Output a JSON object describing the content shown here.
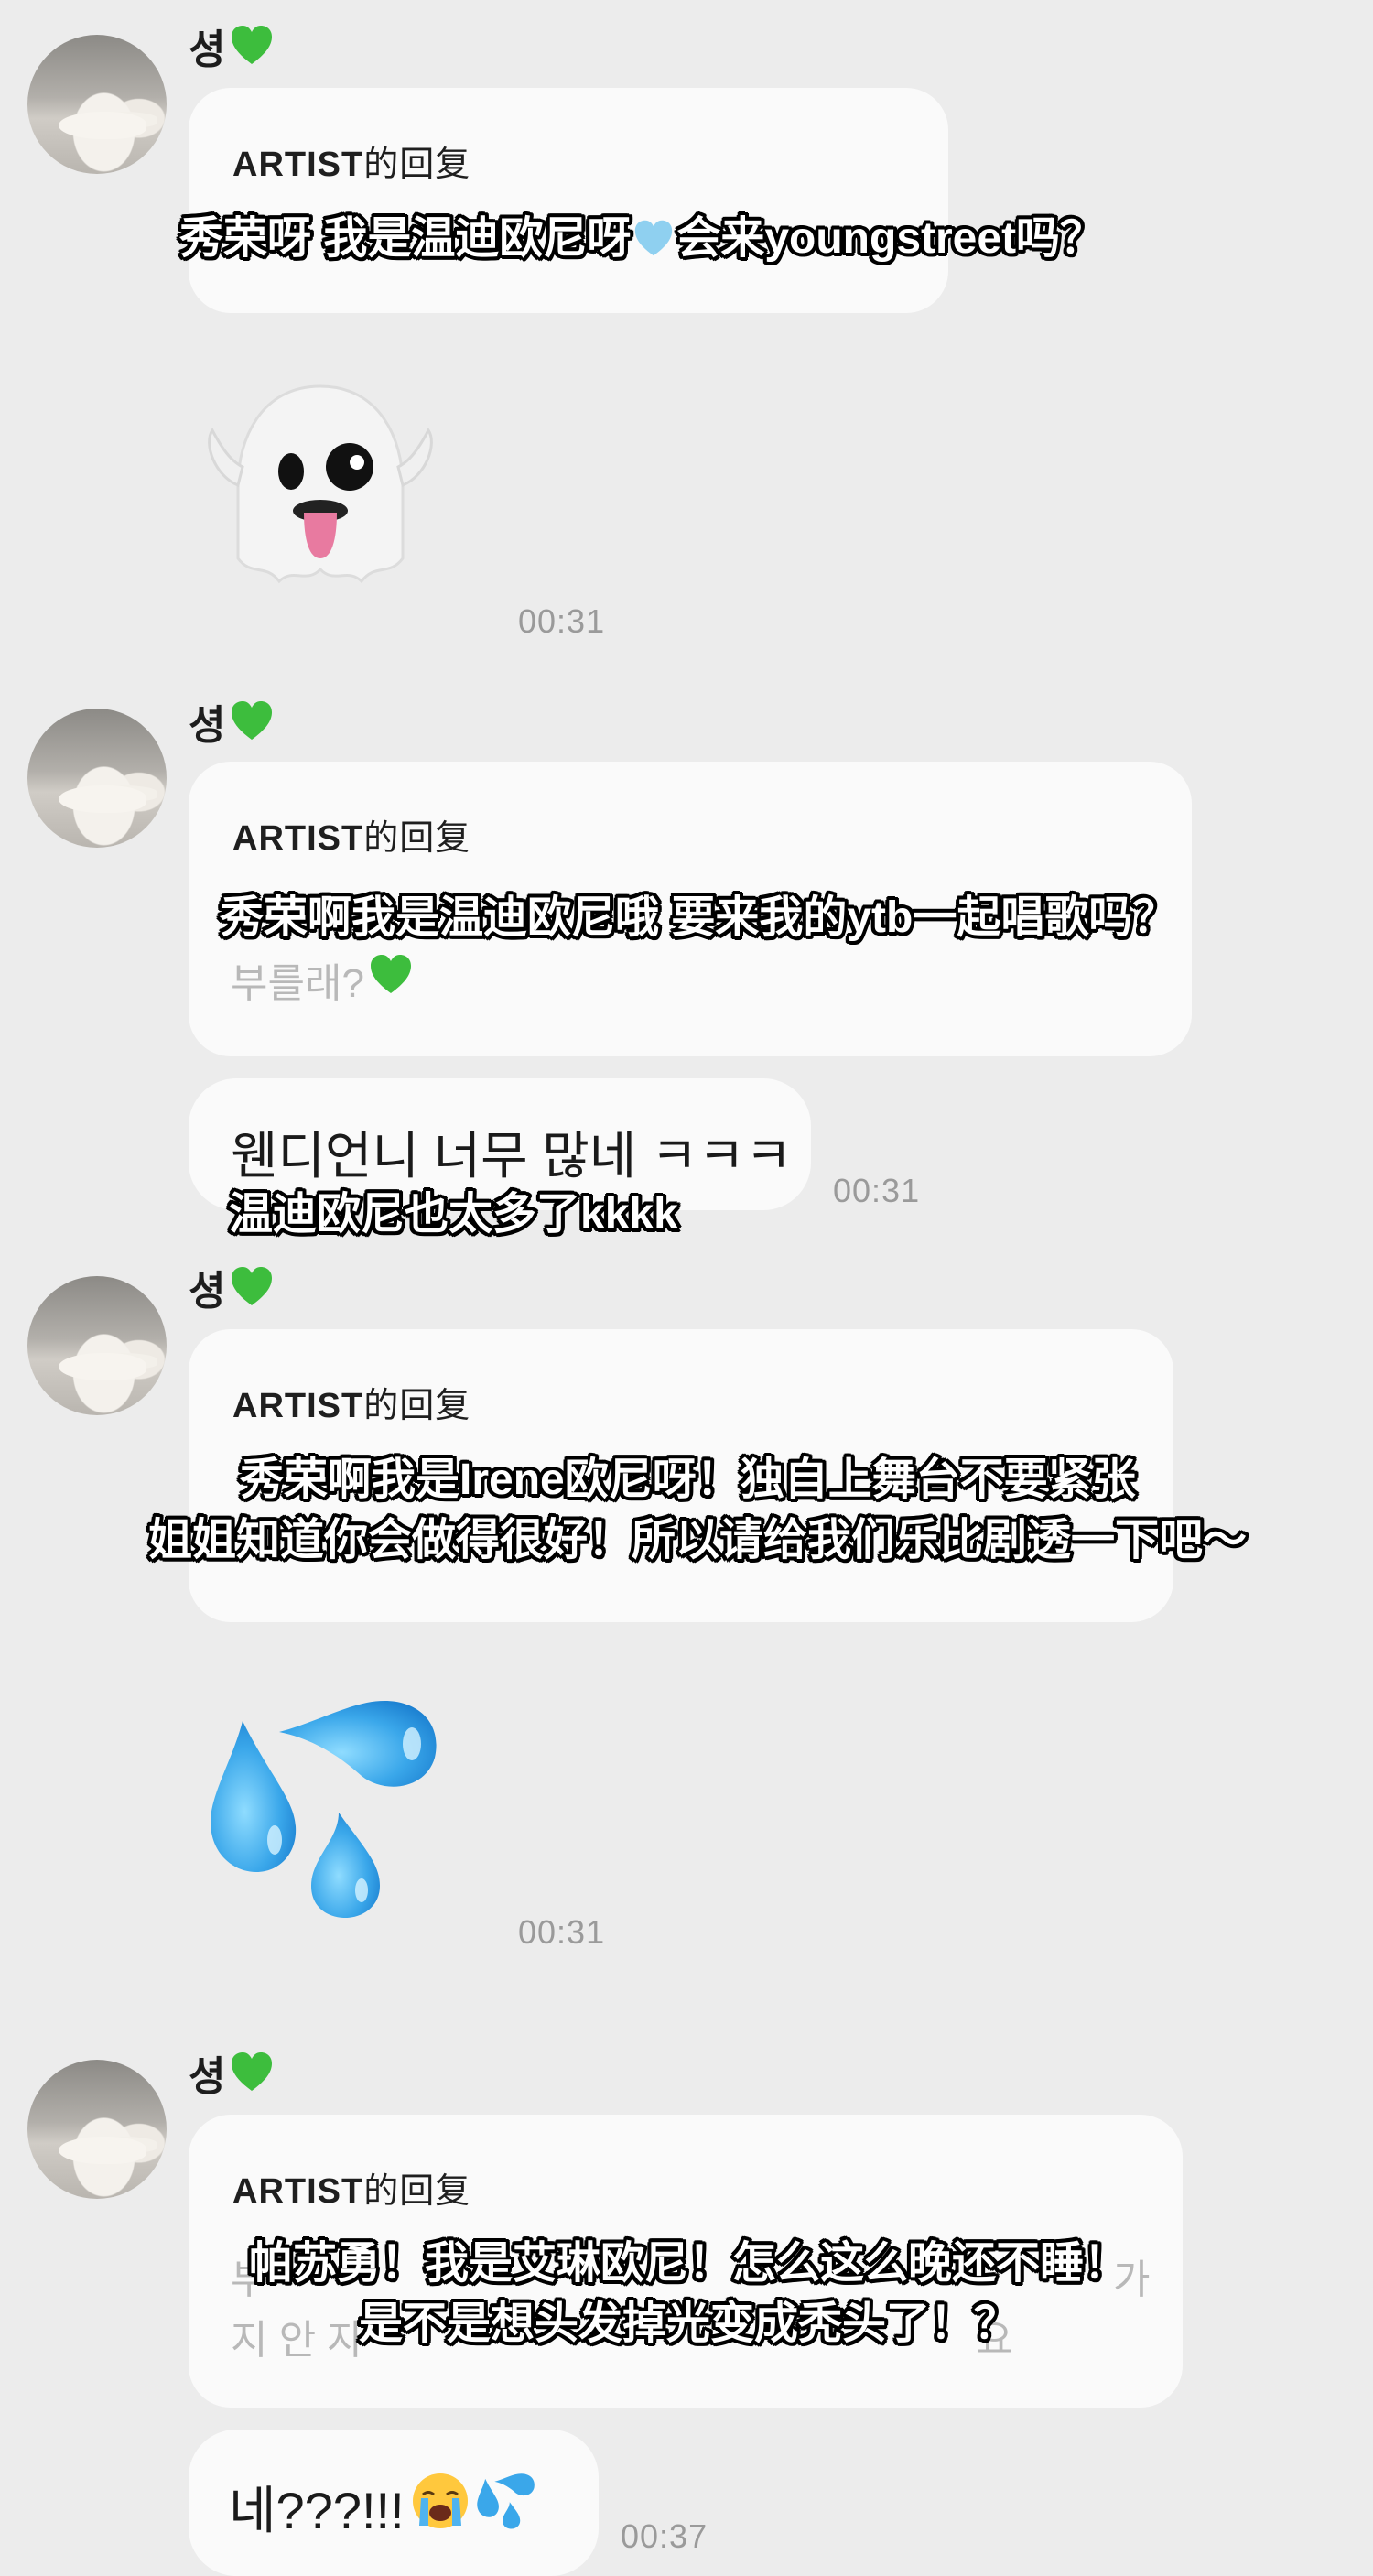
{
  "colors": {
    "background": "#ececec",
    "bubble": "#fafafa",
    "timestamp": "#9a9a9a",
    "muted_text": "#b8b8b8",
    "heart_green": "#3dbd3d",
    "heart_blue": "#8fd0f0"
  },
  "messages": [
    {
      "sender": "셩",
      "sender_icon": "green-heart-icon",
      "reply_title": "ARTIST",
      "reply_suffix": "的回复",
      "subtitle": "秀荣呀 我是温迪欧尼呀",
      "subtitle_icon": "blue-heart-icon",
      "subtitle_tail": "会来youngstreet吗？",
      "sticker": "ghost-sticker-icon",
      "time": "00:31"
    },
    {
      "sender": "셩",
      "sender_icon": "green-heart-icon",
      "reply_title": "ARTIST",
      "reply_suffix": "的回复",
      "subtitle": "秀荣啊我是温迪欧尼哦 要来我的ytb一起唱歌吗？",
      "muted_line": "부를래?",
      "muted_icon": "green-heart-icon",
      "answer_text": "웬디언니 너무 많네 ㅋㅋㅋ",
      "answer_subtitle": "温迪欧尼也太多了kkkk",
      "time": "00:31"
    },
    {
      "sender": "셩",
      "sender_icon": "green-heart-icon",
      "reply_title": "ARTIST",
      "reply_suffix": "的回复",
      "subtitle_line1": "秀荣啊我是Irene欧尼呀！独自上舞台不要紧张",
      "subtitle_line2": "姐姐知道你会做得很好！所以请给我们乐比剧透一下吧～",
      "sticker": "sweat-droplets-sticker-icon",
      "time": "00:31"
    },
    {
      "sender": "셩",
      "sender_icon": "green-heart-icon",
      "reply_title": "ARTIST",
      "reply_suffix": "的回复",
      "subtitle_line1": "帕苏勇！我是艾琳欧尼！怎么这么晚还不睡！",
      "subtitle_line2": "是不是想头发掉光变成秃头了！？",
      "muted_left_1": "부",
      "muted_right_1": "가",
      "muted_left_2": "지 안 자",
      "muted_right_2": "요",
      "answer_text": "네???!!!",
      "answer_icons": [
        "loudly-crying-face-icon",
        "sweat-droplets-icon"
      ],
      "time": "00:37"
    }
  ]
}
